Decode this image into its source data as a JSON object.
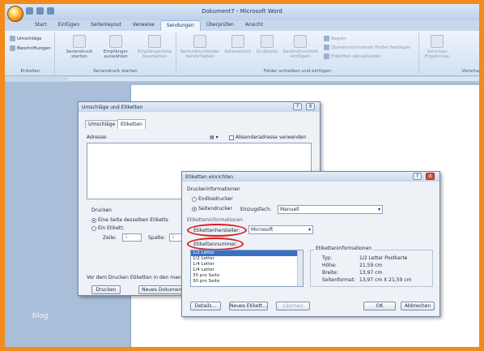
{
  "window": {
    "title": "Dokument7 - Microsoft Word"
  },
  "ribbon": {
    "tabs": [
      "Start",
      "Einfügen",
      "Seitenlayout",
      "Verweise",
      "Sendungen",
      "Überprüfen",
      "Ansicht"
    ],
    "active_tab": "Sendungen",
    "groups": {
      "erstellen": {
        "label": "Erstellen",
        "items": [
          "Umschläge",
          "Beschriftungen"
        ]
      },
      "seriendruck_starten": {
        "label": "Seriendruck starten",
        "items": [
          "Seriendruck starten",
          "Empfänger auswählen",
          "Empfängerliste bearbeiten"
        ]
      },
      "felder": {
        "label": "Felder schreiben und einfügen",
        "items": [
          "Seriendruckfelder hervorheben",
          "Adressblock",
          "Grußzeile",
          "Seriendruckfeld einfügen"
        ],
        "small": [
          "Regeln",
          "Übereinstimmende Felder festlegen",
          "Etiketten aktualisieren"
        ]
      },
      "vorschau": {
        "items": [
          "Vorschau Ergebnisse"
        ],
        "label": "Vorscha"
      }
    }
  },
  "workspace": {
    "blog_text": "blog"
  },
  "dialog_envelopes": {
    "title": "Umschläge und Etiketten",
    "help": "?",
    "close": "X",
    "tabs": [
      "Umschläge",
      "Etiketten"
    ],
    "address_label": "Adresse:",
    "sender_label": "Absenderadresse verwenden",
    "print_label": "Drucken",
    "full_page": "Eine Seite desselben Etiketts",
    "single": "Ein Etikett:",
    "row_label": "Zeile:",
    "row_value": "1",
    "col_label": "Spalte:",
    "col_value": "1",
    "note": "Vor dem Drucken Etiketten in den manuel",
    "print_button": "Drucken",
    "new_doc_button": "Neues Dokument"
  },
  "dialog_labels": {
    "title": "Etiketten einrichten",
    "help": "?",
    "close": "X",
    "printer_info": "Druckerinformationen",
    "continuous": "Endlosdrucker",
    "page_printer": "Seitendrucker",
    "tray_label": "Einzugsfach:",
    "tray_value": "Manuell",
    "label_info": "Etiketteninformationen",
    "vendor_label": "Etikettenhersteller:",
    "vendor_value": "Microsoft",
    "product_label": "Etikettennummer:",
    "products": [
      "1/2 Letter",
      "1/2 Letter",
      "1/4 Letter",
      "1/4 Letter",
      "30 pro Seite",
      "30 pro Seite"
    ],
    "details_title": "Etiketteninformationen",
    "type_label": "Typ:",
    "type_value": "1/2 Letter Postkarte",
    "height_label": "Höhe:",
    "height_value": "21,59 cm",
    "width_label": "Breite:",
    "width_value": "13,97 cm",
    "page_size_label": "Seitenformat:",
    "page_size_value": "13,97 cm X 21,59 cm",
    "details_button": "Details...",
    "new_label_button": "Neues Etikett...",
    "delete_button": "Löschen",
    "ok_button": "OK",
    "cancel_button": "Abbrechen"
  }
}
